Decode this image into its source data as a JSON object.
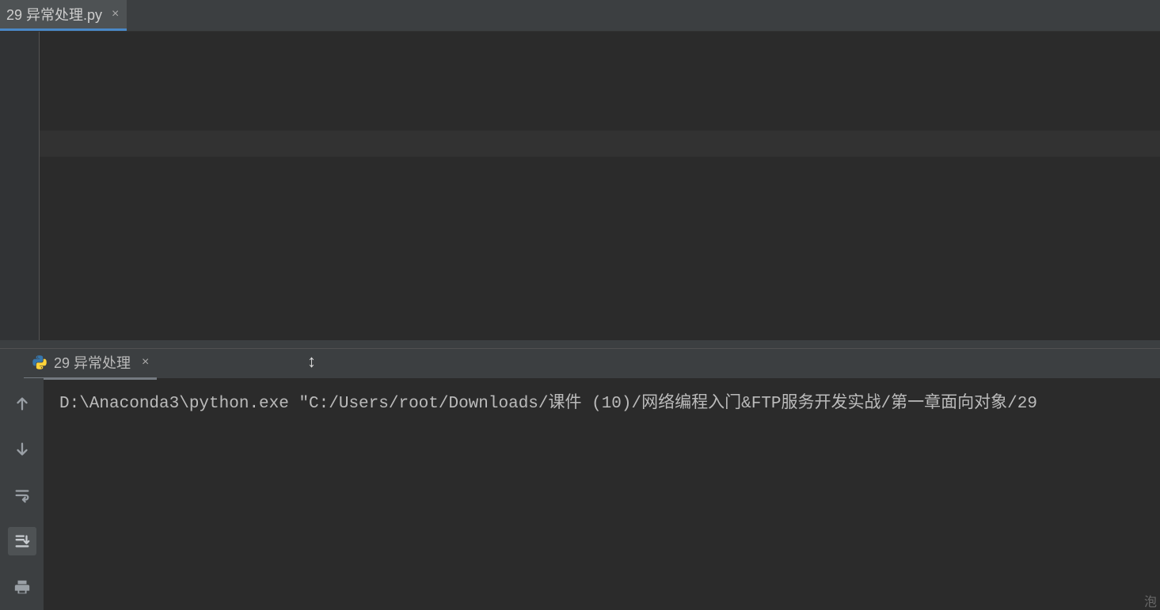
{
  "editor": {
    "tab": {
      "label": "29 异常处理.py"
    }
  },
  "run": {
    "tab": {
      "label": "29 异常处理"
    },
    "console_output": "D:\\Anaconda3\\python.exe \"C:/Users/root/Downloads/课件 (10)/网络编程入门&FTP服务开发实战/第一章面向对象/29"
  },
  "icons": {
    "close": "×",
    "resize_vertical": "↕"
  },
  "corner": "泡"
}
